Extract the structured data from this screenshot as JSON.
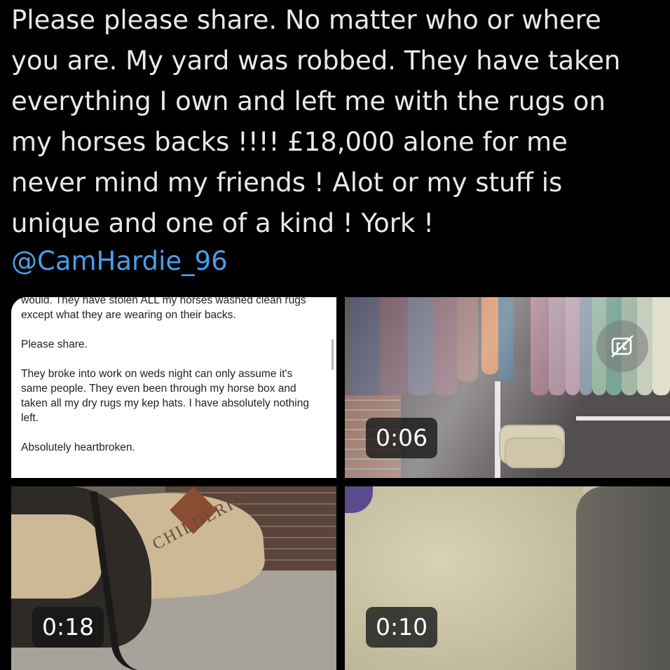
{
  "tweet": {
    "text_lines": [
      "Please please share. No matter who or where",
      "you are. My yard was robbed. They have taken",
      "everything I own and left me with the rugs on",
      "my horses backs !!!! £18,000 alone for me",
      "never mind my friends ! Alot or my stuff is",
      "unique and one of a kind ! York !"
    ],
    "mention": "@CamHardie_96"
  },
  "media": {
    "image1": {
      "paragraphs": [
        "would. They have stolen ALL my horses washed clean rugs except what they are wearing on their backs.",
        "Please share.",
        "They broke into work on weds night can only assume it's same people. They even been through my horse box and taken all my dry rugs my kep hats. I have absolutely nothing left.",
        "Absolutely heartbroken."
      ]
    },
    "video1": {
      "duration": "0:06",
      "icon": "captions-off-icon"
    },
    "video2": {
      "duration": "0:18",
      "brand_text": "CHILDERIC"
    },
    "video3": {
      "duration": "0:10"
    }
  },
  "colors": {
    "background": "#000000",
    "text": "#e7e9ea",
    "mention": "#4a9fea"
  }
}
